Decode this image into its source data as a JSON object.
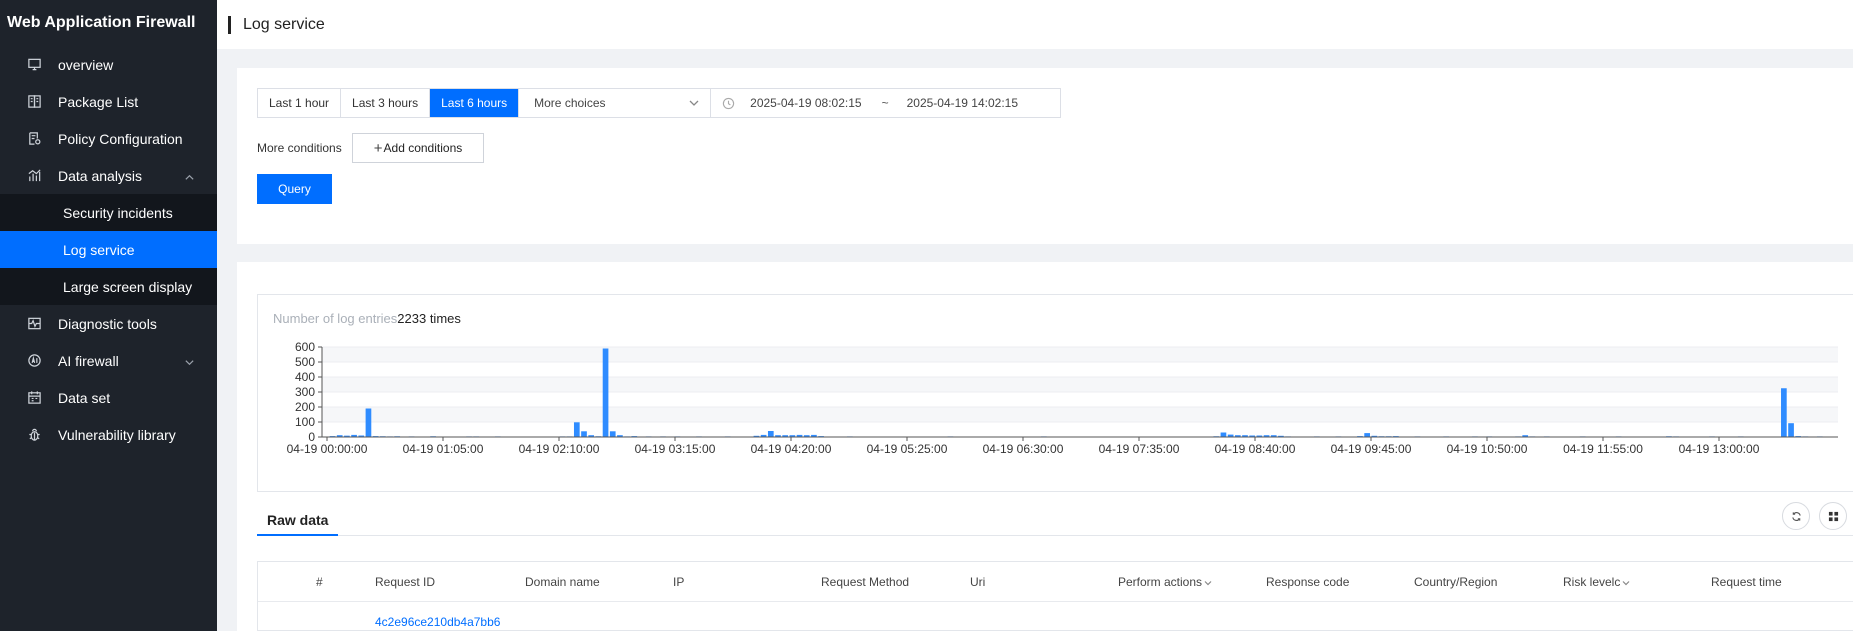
{
  "app": {
    "title": "Web Application Firewall"
  },
  "sidebar": {
    "items": [
      {
        "label": "overview",
        "icon": "monitor-icon"
      },
      {
        "label": "Package List",
        "icon": "package-list-icon"
      },
      {
        "label": "Policy Configuration",
        "icon": "policy-config-icon"
      },
      {
        "label": "Data analysis",
        "icon": "analytics-icon"
      },
      {
        "label": "Diagnostic tools",
        "icon": "diagnostic-icon"
      },
      {
        "label": "AI firewall",
        "icon": "ai-firewall-icon"
      },
      {
        "label": "Data set",
        "icon": "calendar-dataset-icon"
      },
      {
        "label": "Vulnerability library",
        "icon": "bug-icon"
      }
    ],
    "subitems": [
      {
        "label": "Security incidents"
      },
      {
        "label": "Log service"
      },
      {
        "label": "Large screen display"
      }
    ]
  },
  "header": {
    "title": "Log service"
  },
  "query": {
    "ranges": [
      "Last 1 hour",
      "Last 3 hours",
      "Last 6 hours"
    ],
    "active_range": "Last 6 hours",
    "more_choices": "More choices",
    "date_start": "2025-04-19 08:02:15",
    "date_sep": "~",
    "date_end": "2025-04-19 14:02:15",
    "more_conditions_label": "More conditions",
    "add_conditions": "Add conditions",
    "query_button": "Query"
  },
  "chart_data": {
    "type": "bar",
    "summary_label": "Number of log entries",
    "summary_value": "2233 times",
    "ylim": [
      0,
      600
    ],
    "yticks": [
      0,
      100,
      200,
      300,
      400,
      500,
      600
    ],
    "xtick_labels": [
      "04-19 00:00:00",
      "04-19 01:05:00",
      "04-19 02:10:00",
      "04-19 03:15:00",
      "04-19 04:20:00",
      "04-19 05:25:00",
      "04-19 06:30:00",
      "04-19 07:35:00",
      "04-19 08:40:00",
      "04-19 09:45:00",
      "04-19 10:50:00",
      "04-19 11:55:00",
      "04-19 13:00:00"
    ],
    "bar_color": "#2f8cff",
    "values": [
      3,
      6,
      12,
      9,
      14,
      10,
      190,
      6,
      5,
      4,
      5,
      3,
      4,
      3,
      2,
      5,
      2,
      3,
      3,
      2,
      4,
      4,
      3,
      3,
      4,
      2,
      3,
      3,
      2,
      3,
      3,
      2,
      3,
      4,
      4,
      98,
      38,
      12,
      5,
      590,
      38,
      12,
      4,
      6,
      3,
      4,
      3,
      4,
      2,
      4,
      3,
      2,
      4,
      3,
      3,
      2,
      4,
      3,
      2,
      3,
      8,
      14,
      40,
      12,
      12,
      12,
      14,
      12,
      14,
      6,
      3,
      2,
      3,
      4,
      3,
      2,
      3,
      3,
      2,
      3,
      3,
      2,
      2,
      3,
      3,
      2,
      3,
      4,
      3,
      2,
      3,
      3,
      3,
      2,
      3,
      2,
      3,
      2,
      3,
      3,
      4,
      3,
      2,
      3,
      2,
      3,
      2,
      3,
      3,
      2,
      2,
      3,
      3,
      2,
      3,
      3,
      2,
      3,
      3,
      2,
      3,
      2,
      3,
      3,
      5,
      30,
      16,
      12,
      12,
      10,
      10,
      12,
      12,
      8,
      4,
      3,
      2,
      3,
      4,
      3,
      2,
      4,
      3,
      3,
      6,
      26,
      8,
      5,
      5,
      6,
      3,
      3,
      4,
      3,
      2,
      3,
      4,
      3,
      2,
      3,
      4,
      3,
      4,
      2,
      3,
      3,
      4,
      12,
      4,
      3,
      4,
      2,
      3,
      3,
      2,
      4,
      3,
      3,
      2,
      3,
      4,
      2,
      3,
      3,
      2,
      3,
      3,
      5,
      4,
      3,
      2,
      3,
      3,
      4,
      2,
      3,
      3,
      4,
      2,
      3,
      3,
      3,
      2,
      325,
      92,
      6,
      4,
      3,
      4,
      3,
      2
    ]
  },
  "raw_data": {
    "tab": "Raw data",
    "columns": [
      "#",
      "Request ID",
      "Domain name",
      "IP",
      "Request Method",
      "Uri",
      "Perform actions",
      "Response code",
      "Country/Region",
      "Risk levelc",
      "Request time"
    ],
    "first_request_id": "4c2e96ce210db4a7bb6"
  }
}
